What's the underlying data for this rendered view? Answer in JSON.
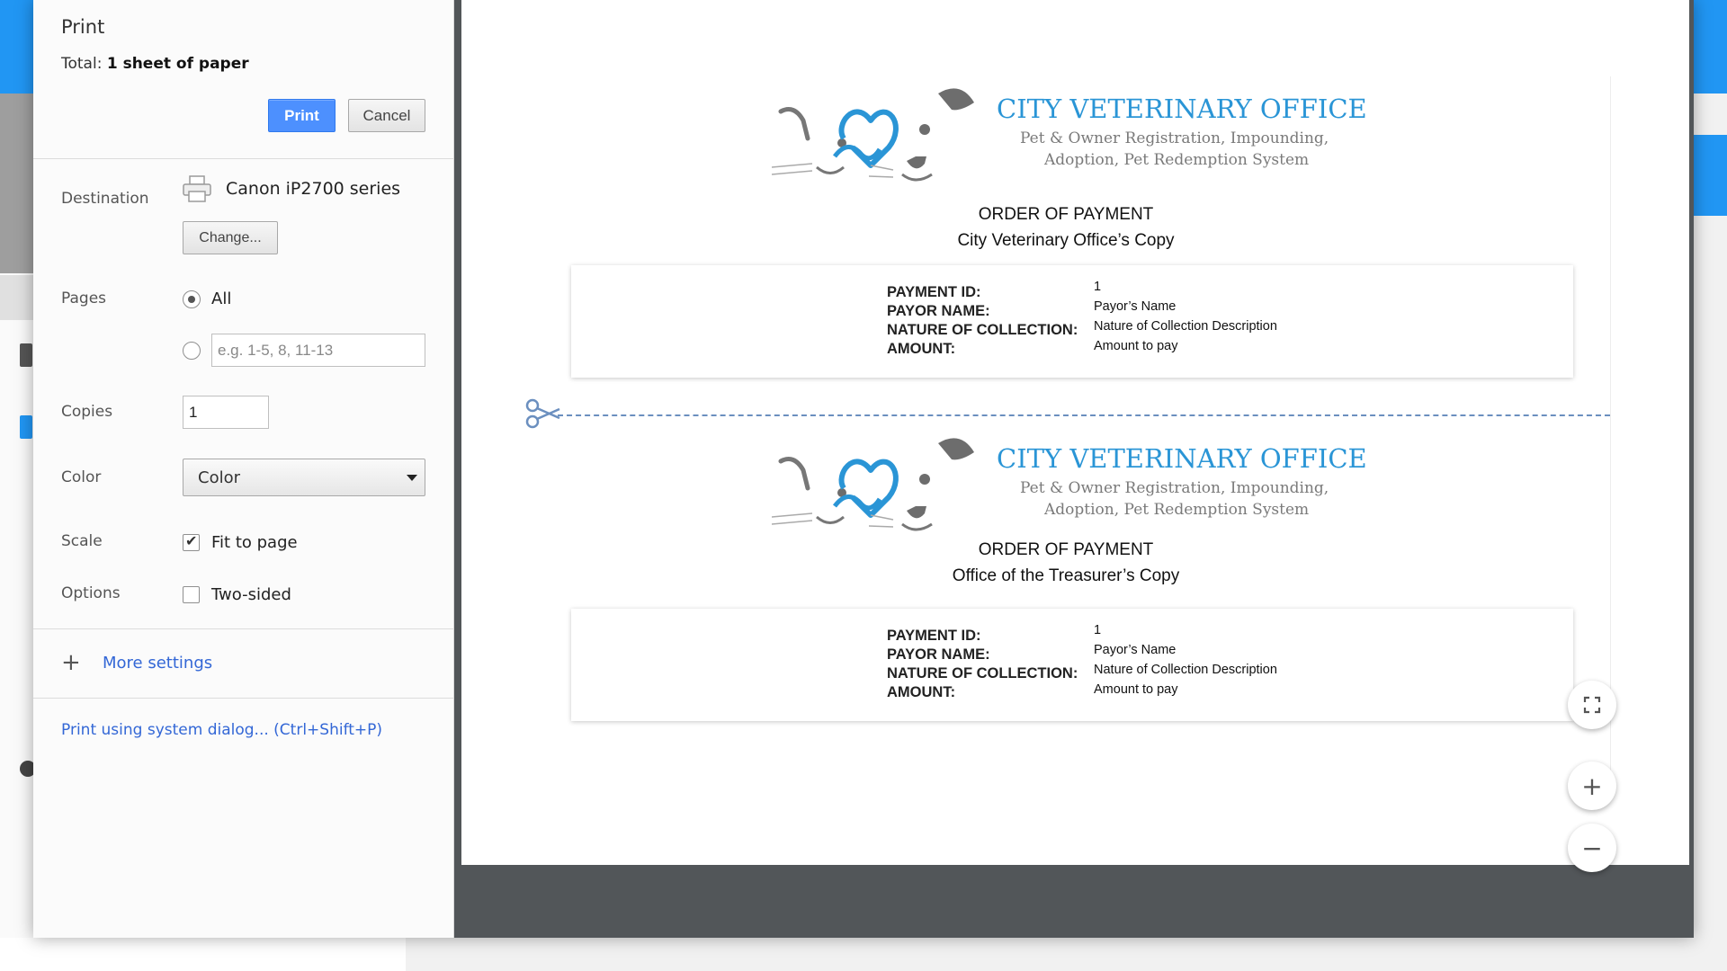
{
  "dialog": {
    "title": "Print",
    "total_prefix": "Total: ",
    "total_value": "1 sheet of paper",
    "print_button": "Print",
    "cancel_button": "Cancel"
  },
  "destination": {
    "label": "Destination",
    "printer_name": "Canon iP2700 series",
    "change_button": "Change..."
  },
  "pages": {
    "label": "Pages",
    "all_option": "All",
    "selected": "All",
    "custom_placeholder": "e.g. 1-5, 8, 11-13"
  },
  "copies": {
    "label": "Copies",
    "value": "1"
  },
  "color": {
    "label": "Color",
    "selected": "Color"
  },
  "scale": {
    "label": "Scale",
    "option": "Fit to page",
    "checked": true
  },
  "options": {
    "label": "Options",
    "option": "Two-sided",
    "checked": false
  },
  "more_settings": "More settings",
  "system_dialog_link": "Print using system dialog... (Ctrl+Shift+P)",
  "preview": {
    "org_name": "CITY VETERINARY OFFICE",
    "org_sub_1": "Pet & Owner Registration, Impounding,",
    "org_sub_2": "Adoption, Pet Redemption System",
    "copies": [
      {
        "heading": "ORDER OF PAYMENT",
        "copy_name": "City Veterinary Office’s Copy",
        "fields": {
          "payment_id_label": "PAYMENT ID:",
          "payor_name_label": "PAYOR NAME:",
          "nature_label": "NATURE OF COLLECTION:",
          "amount_label": "AMOUNT:",
          "payment_id": "1",
          "payor_name": "Payor’s Name",
          "nature": "Nature of Collection Description",
          "amount": "Amount to pay"
        }
      },
      {
        "heading": "ORDER OF PAYMENT",
        "copy_name": "Office of the Treasurer’s Copy",
        "fields": {
          "payment_id_label": "PAYMENT ID:",
          "payor_name_label": "PAYOR NAME:",
          "nature_label": "NATURE OF COLLECTION:",
          "amount_label": "AMOUNT:",
          "payment_id": "1",
          "payor_name": "Payor’s Name",
          "nature": "Nature of Collection Description",
          "amount": "Amount to pay"
        }
      }
    ]
  },
  "icons": {
    "fit": "fit-to-width-icon",
    "zoom_in": "zoom-in-icon",
    "zoom_out": "zoom-out-icon",
    "scissors": "scissors-icon",
    "printer": "printer-icon",
    "plus": "plus-icon"
  },
  "colors": {
    "accent_blue": "#4d90fe",
    "link_blue": "#3367d6",
    "brand_blue": "#2a95d6",
    "preview_bg": "#525659"
  }
}
